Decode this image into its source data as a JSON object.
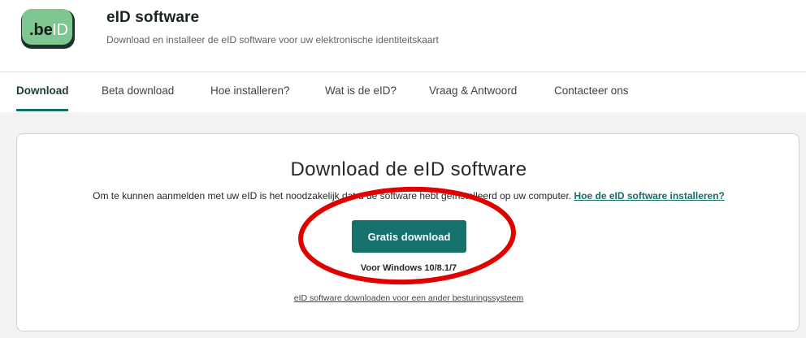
{
  "header": {
    "logo_text_be": ".be",
    "logo_text_id": "ID",
    "title": "eID software",
    "subtitle": "Download en installeer de eID software voor uw elektronische identiteitskaart"
  },
  "nav": {
    "tabs": [
      {
        "label": "Download",
        "active": true
      },
      {
        "label": "Beta download",
        "active": false
      },
      {
        "label": "Hoe installeren?",
        "active": false
      },
      {
        "label": "Wat is de eID?",
        "active": false
      },
      {
        "label": "Vraag & Antwoord",
        "active": false
      },
      {
        "label": "Contacteer ons",
        "active": false
      }
    ]
  },
  "card": {
    "title": "Download de eID software",
    "description": "Om te kunnen aanmelden met uw eID is het noodzakelijk dat u de software hebt geïnstalleerd op uw computer.",
    "install_link": "Hoe de eID software installeren?",
    "download_button": "Gratis download",
    "os_note": "Voor Windows 10/8.1/7",
    "other_os_link": "eID software downloaden voor een ander besturingssysteem"
  },
  "colors": {
    "accent": "#16706c",
    "annotation": "#e10000",
    "logo_green": "#7fc790"
  }
}
